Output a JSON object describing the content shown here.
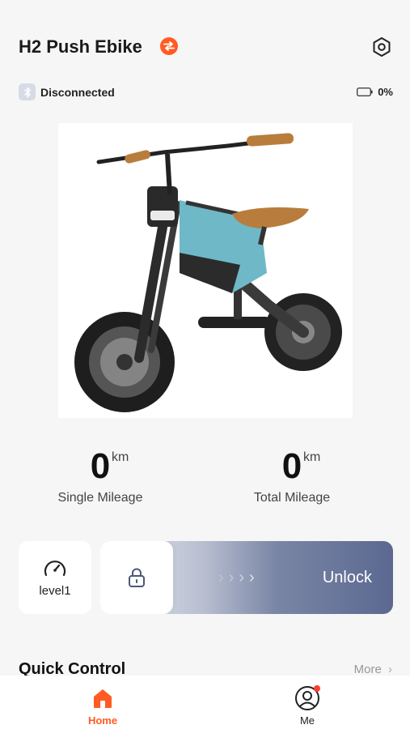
{
  "header": {
    "title": "H2 Push Ebike"
  },
  "status": {
    "connection": "Disconnected",
    "battery": "0%",
    "battery_fraction": 0
  },
  "stats": [
    {
      "value": "0",
      "unit": "km",
      "label": "Single Mileage"
    },
    {
      "value": "0",
      "unit": "km",
      "label": "Total Mileage"
    }
  ],
  "controls": {
    "level_label": "level1",
    "unlock_label": "Unlock"
  },
  "quick_control": {
    "title": "Quick Control",
    "more_label": "More"
  },
  "tabbar": {
    "home": "Home",
    "me": "Me"
  },
  "colors": {
    "accent": "#ff5b22",
    "slider_dark": "#5b6891",
    "background": "#f6f6f6",
    "notification": "#ff3b30"
  },
  "icons": {
    "swap": "swap-icon",
    "settings": "settings-icon",
    "bluetooth": "bluetooth-icon",
    "battery": "battery-icon",
    "speedometer": "speedometer-icon",
    "lock": "lock-icon",
    "home": "home-icon",
    "profile": "profile-icon"
  }
}
